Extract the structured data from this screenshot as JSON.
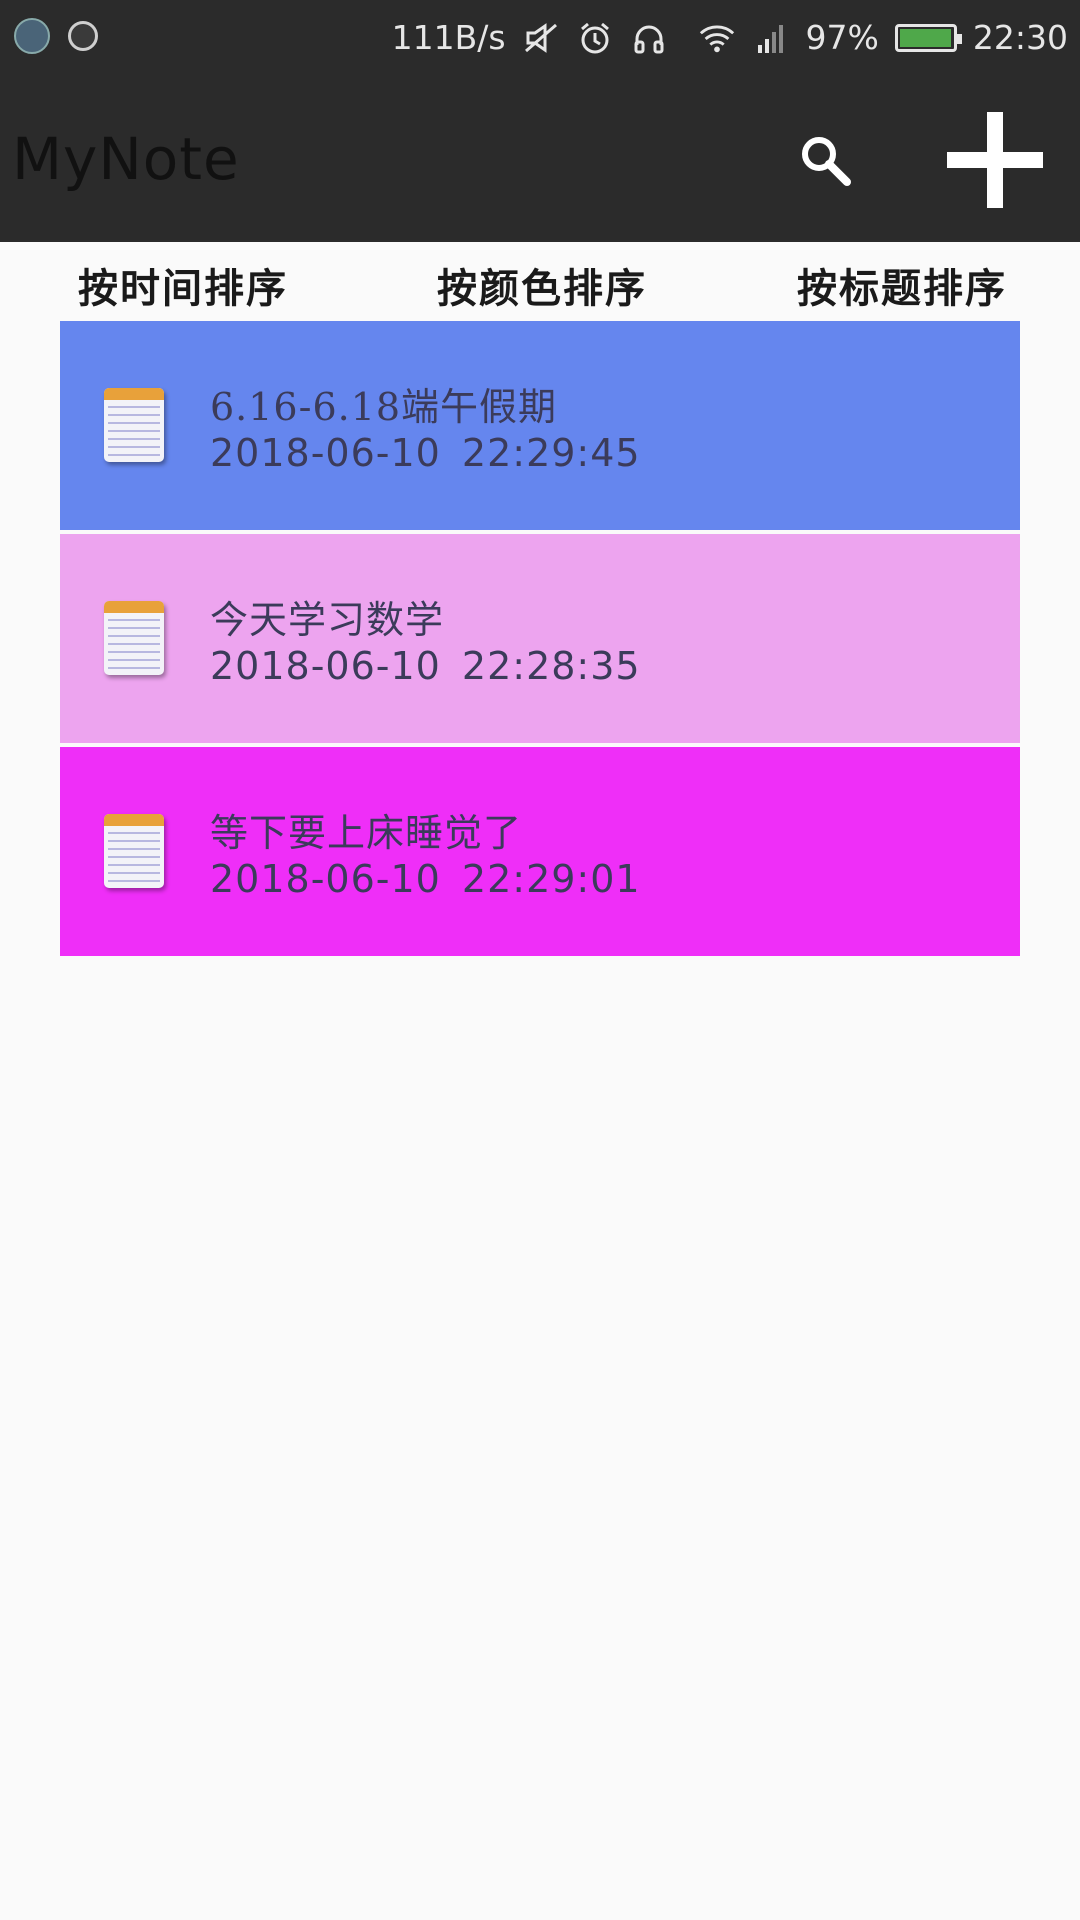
{
  "status_bar": {
    "net_speed": "111B/s",
    "battery_percent": "97%",
    "battery_level": 0.97,
    "time": "22:30",
    "icons": [
      "notification-app-icon",
      "notification-app-icon-2",
      "mute-icon",
      "alarm-icon",
      "headphones-icon",
      "wifi-icon",
      "signal-icon",
      "battery-icon"
    ]
  },
  "app_bar": {
    "title": "MyNote",
    "actions": [
      "search-icon",
      "add-icon"
    ]
  },
  "sort_bar": {
    "by_time": "按时间排序",
    "by_color": "按颜色排序",
    "by_title": "按标题排序"
  },
  "notes": [
    {
      "title": "6.16-6.18端午假期",
      "time": "2018-06-10 22:29:45",
      "color": "#6586ee"
    },
    {
      "title": "今天学习数学",
      "time": "2018-06-10 22:28:35",
      "color": "#eda4ef"
    },
    {
      "title": "等下要上床睡觉了",
      "time": "2018-06-10 22:29:01",
      "color": "#ef2ef8"
    }
  ]
}
